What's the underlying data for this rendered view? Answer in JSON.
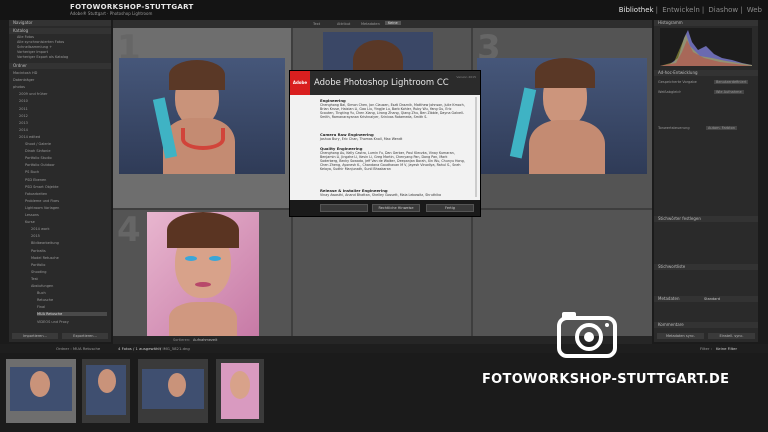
{
  "header": {
    "brand_small": "FOTOWORKSHOP-STUTTGART",
    "brand_sub": "Adobe® Stuttgart · Photoshop Lightroom",
    "modules": [
      "Bibliothek",
      "Entwickeln",
      "Diashow",
      "Web"
    ],
    "active_module": "Bibliothek"
  },
  "left_panel": {
    "navigator_label": "Navigator",
    "catalog_label": "Katalog",
    "catalog_items": [
      "Alle Fotos",
      "Alle synchronisierten Fotos",
      "Schnellsammlung +",
      "Vorheriger Import",
      "Vorheriger Export als Katalog"
    ],
    "folders_label": "Ordner",
    "folders": [
      "Macintosh HD",
      "Datenträger",
      "photos",
      "2009 und früher",
      "2010",
      "2011",
      "2012",
      "2013",
      "2014",
      "2014 edited",
      "Shoot / Galerie",
      "Dinah Sinfonie",
      "Portfolio Studio",
      "Portfolio Outdoor",
      "PS Buch",
      "PSD Ebenen",
      "PSD Smart Objekte",
      "Fotoarbeiten",
      "Probleme und Fixes",
      "Lightroom Vorlagen",
      "Lessons",
      "Kurse",
      "2014 work",
      "2015",
      "Bildbearbeitung",
      "Portraits",
      "Model Retusche",
      "Portfolio",
      "Shooting",
      "Test",
      "Abstufungen",
      "Buch",
      "Retusche",
      "Final",
      "MUA Retusche",
      "VIDEOS und Proxy"
    ],
    "import_button": "Importieren...",
    "export_button": "Exportieren..."
  },
  "grid": {
    "toolbar_items": [
      "Text",
      "Attribut",
      "Metadaten",
      "Keine"
    ],
    "cell_numbers": [
      "1",
      "2",
      "3",
      "4"
    ],
    "sort_label": "Sortieren:",
    "sort_value": "Aufnahmezeit"
  },
  "dialog": {
    "adobe_logo": "Adobe",
    "title": "Adobe Photoshop Lightroom CC",
    "version": "Version 2015",
    "sections": [
      {
        "heading": "Engineering",
        "text": "Chenghong Bai, Simon Chen, Jon Clausen, Eszti Draznik, Matthew Johnson, Julie Kmoch, Brian Kruse, Haixian Li, Gao Liu, Yingjie Lu, Barb Kohler, Ruby Wu, Yang Gu, Eric Scouten, Tingting Yu, Chen Xiang, Lirong Zhang, Qiang Zhu, Ben Zibble, Dayna Galvell-Smith, Ramanarayanan Krishnaiyer, Srinivas Rotameda, Smith S."
      },
      {
        "heading": "Camera Raw Engineering",
        "text": "Joshua Bury, Eric Chan, Thomas Knoll, Max Wendt"
      },
      {
        "heading": "Quality Engineering",
        "text": "Chenghong Au, Kelly Castro, Lumin Fu, Dan Gerber, Paul Kleczka, Vinay Kumaran, Benjamin Li, Jingzhe Li, Kevin Li, Greg Martin, Chenyang Pan, Dong Pan, Mark Soderberg, Becky Sowada, Jeff Van de Walker, Deepanjan Borah, Xin Wu, Chunyu Hong, Chen Zheng, Ayonesh K., Chandana Goudhavan M V, Jayesh Vinodiya, Rahul S., Sneh Kelaya, Sudhir Manjunath, Sunil Bhaskaran"
      },
      {
        "heading": "Release & Installer Engineering",
        "text": "Vinay Awasthi, Anand Bhattan, Shelley Gossett, Maia Lebowitz, Shruthika"
      }
    ],
    "buttons": [
      "",
      "Rechtliche Hinweise",
      "Fertig"
    ]
  },
  "right_panel": {
    "histogram_label": "Histogramm",
    "quick_develop_label": "Ad-hoc-Entwicklung",
    "saved_preset_label": "Gespeicherte Vorgabe",
    "saved_preset_value": "Benutzerdefiniert",
    "white_balance_label": "Weißabgleich",
    "white_balance_value": "Wie Aufnahme",
    "tone_control_label": "Tonwertsteuerung",
    "tone_control_button": "Autom. Farbton",
    "keywording_label": "Stichwörter festlegen",
    "keyword_list_label": "Stichwortliste",
    "metadata_label": "Metadaten",
    "metadata_value": "Standard",
    "comments_label": "Kommentare",
    "sync_meta_button": "Metadaten sync.",
    "sync_settings_button": "Einstell. sync."
  },
  "filmstrip": {
    "source_label": "Ordner : MUA Retusche",
    "count_text": "4 Fotos / 1 ausgewählt",
    "filename": "/ IMG_5821.dng",
    "filter_label": "Filter :",
    "filter_value": "Keine Filter"
  },
  "watermark": {
    "brand": "FOTOWORKSHOP-STUTTGART.DE"
  },
  "colors": {
    "adobe_red": "#d91f1f",
    "panel": "#2a2a2a",
    "grid_bg": "#3e3e3e",
    "selected_cell": "#7a7a7a"
  }
}
